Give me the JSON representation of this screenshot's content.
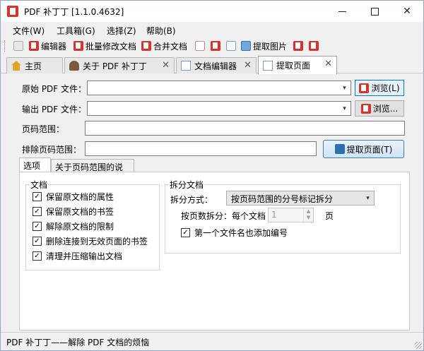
{
  "window": {
    "title": "PDF 补丁丁 [1.1.0.4632]"
  },
  "menu": [
    "文件(W)",
    "工具箱(G)",
    "选择(Z)",
    "帮助(B)"
  ],
  "toolbar": {
    "editor": "编辑器",
    "batch_modify": "批量修改文档",
    "merge": "合并文档",
    "extract_images": "提取图片"
  },
  "tabs": [
    "主页",
    "关于 PDF 补丁丁",
    "文档编辑器",
    "提取页面"
  ],
  "form": {
    "source_label": "原始 PDF 文件：",
    "source_value": "",
    "output_label": "输出 PDF 文件：",
    "output_value": "",
    "browse_source": "浏览(L)",
    "browse_output": "浏览...",
    "page_range_label": "页码范围：",
    "page_range_value": "",
    "exclude_label": "排除页码范围：",
    "exclude_value": "",
    "extract_button": "提取页面(T)"
  },
  "inner_tabs": [
    "选项",
    "关于页码范围的说明"
  ],
  "doc_group": {
    "title": "文档",
    "options": [
      {
        "label": "保留原文档的属性",
        "checked": true
      },
      {
        "label": "保留原文档的书签",
        "checked": true
      },
      {
        "label": "解除原文档的限制",
        "checked": true
      },
      {
        "label": "删除连接到无效页面的书签",
        "checked": true
      },
      {
        "label": "清理并压缩输出文档",
        "checked": true
      }
    ]
  },
  "split_group": {
    "title": "拆分文档",
    "mode_label": "拆分方式：",
    "mode_value": "按页码范围的分号标记拆分",
    "pages_label": "按页数拆分：每个文档",
    "pages_value": "1",
    "pages_unit": "页",
    "number_label": "第一个文件名也添加编号",
    "number_checked": true
  },
  "status": "PDF 补丁丁——解除 PDF 文档的烦恼"
}
